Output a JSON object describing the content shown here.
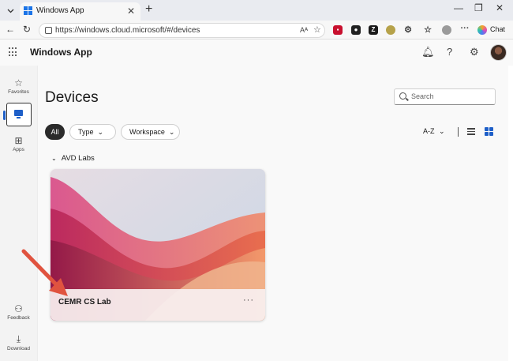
{
  "browser": {
    "tab_title": "Windows App",
    "url": "https://windows.cloud.microsoft/#/devices",
    "chat_label": "Chat",
    "ext_z_label": "Z"
  },
  "app": {
    "title": "Windows App"
  },
  "rail": {
    "items": [
      {
        "label": "Favorites",
        "icon": "star-icon"
      },
      {
        "label": "",
        "icon": "monitor-icon"
      },
      {
        "label": "Apps",
        "icon": "apps-icon"
      },
      {
        "label": "Feedback",
        "icon": "feedback-icon"
      },
      {
        "label": "Download",
        "icon": "download-icon"
      }
    ]
  },
  "page": {
    "title": "Devices",
    "search_placeholder": "Search",
    "filters": [
      {
        "label": "All",
        "active": true
      },
      {
        "label": "Type",
        "active": false
      },
      {
        "label": "Workspace",
        "active": false
      }
    ],
    "sort_label": "A-Z",
    "group_name": "AVD Labs",
    "devices": [
      {
        "name": "CEMR CS Lab"
      }
    ]
  },
  "colors": {
    "accent": "#1e5fc8",
    "annotation_arrow": "#e0533f"
  }
}
